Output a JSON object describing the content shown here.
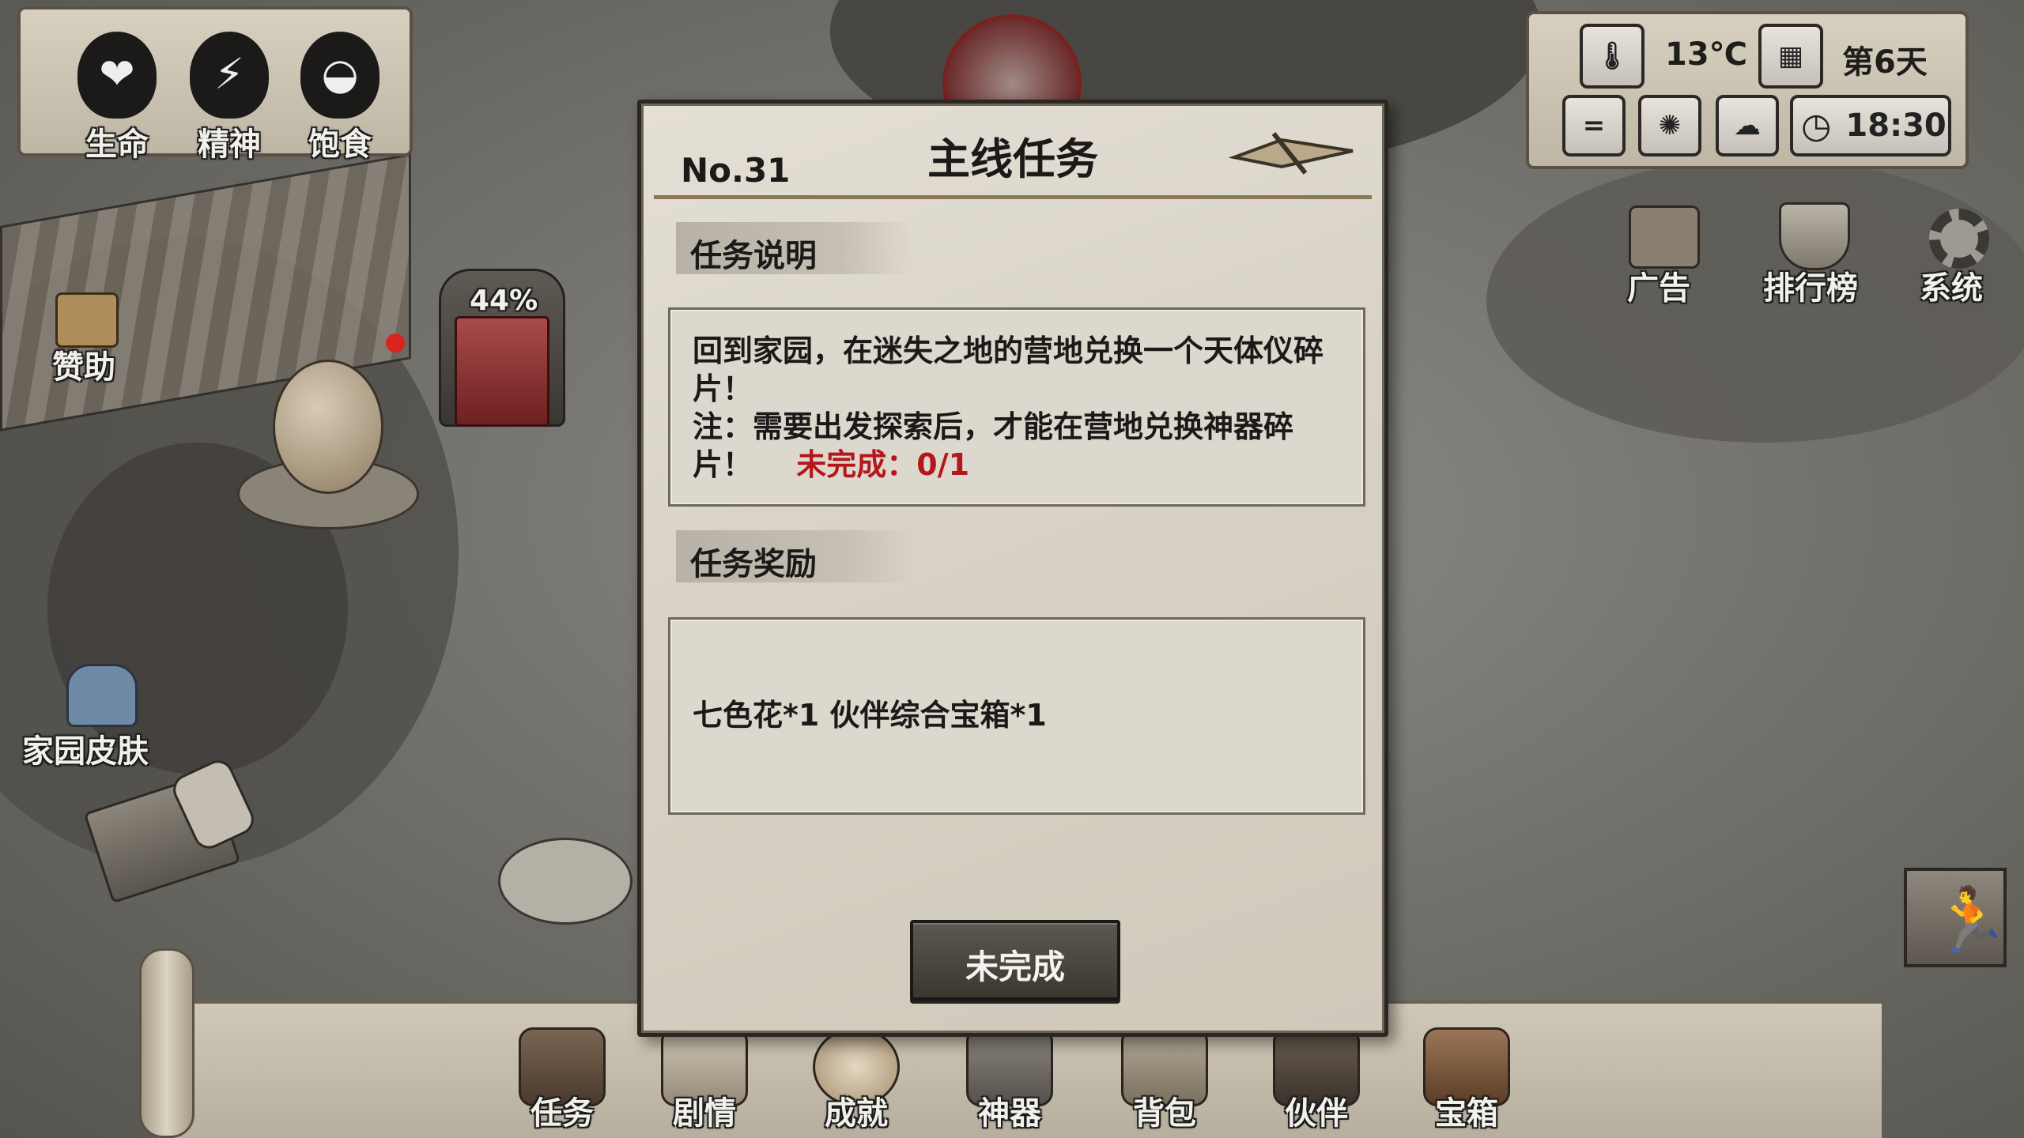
{
  "stats": [
    {
      "key": "life",
      "label": "生命",
      "glyph": "❤"
    },
    {
      "key": "spirit",
      "label": "精神",
      "glyph": "⚡"
    },
    {
      "key": "satiety",
      "label": "饱食",
      "glyph": "◒"
    }
  ],
  "weather": {
    "temperature": "13℃",
    "day": "第6天",
    "time": "18:30"
  },
  "left_menu": {
    "sponsor": "赞助",
    "home_skin": "家园皮肤"
  },
  "pot_progress": "44%",
  "right_menu": {
    "ad": "广告",
    "ranking": "排行榜",
    "system": "系统"
  },
  "dialog": {
    "number": "No.31",
    "title": "主线任务",
    "desc_header": "任务说明",
    "desc_text": "回到家园，在迷失之地的营地兑换一个天体仪碎片！",
    "desc_note": "注：需要出发探索后，才能在营地兑换神器碎片！",
    "status_label": "未完成：0/1",
    "reward_header": "任务奖励",
    "reward_text": "七色花*1 伙伴综合宝箱*1",
    "button_label": "未完成"
  },
  "bottom_bar": [
    {
      "key": "quest",
      "label": "任务"
    },
    {
      "key": "story",
      "label": "剧情"
    },
    {
      "key": "achievement",
      "label": "成就"
    },
    {
      "key": "artifact",
      "label": "神器"
    },
    {
      "key": "backpack",
      "label": "背包"
    },
    {
      "key": "partner",
      "label": "伙伴"
    },
    {
      "key": "chest",
      "label": "宝箱"
    }
  ]
}
